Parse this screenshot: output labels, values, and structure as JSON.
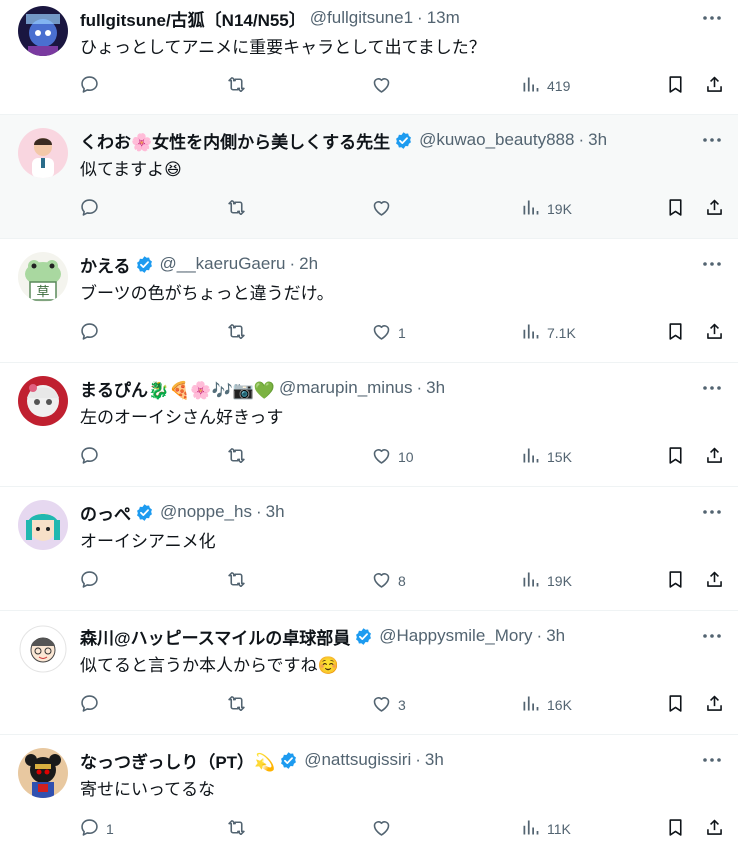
{
  "colors": {
    "text": "#0f1419",
    "secondary": "#536471",
    "verified": "#1d9bf0",
    "divider": "#eff3f4",
    "hover_bg": "#f7f9f9"
  },
  "tweets": [
    {
      "name": "fullgitsune/古狐〔N14/N55〕",
      "handle": "@fullgitsune1",
      "time": "13m",
      "verified": false,
      "text": "ひょっとしてアニメに重要キャラとして出てました？",
      "replies": "",
      "likes": "",
      "views": "419",
      "avatar_icon": "avatar-fullgitsune"
    },
    {
      "name": "くわお🌸女性を内側から美しくする先生",
      "handle": "@kuwao_beauty888",
      "time": "3h",
      "verified": true,
      "text": "似てますよ😆",
      "replies": "",
      "likes": "",
      "views": "19K",
      "avatar_icon": "avatar-kuwao"
    },
    {
      "name": "かえる",
      "handle": "@__kaeruGaeru",
      "time": "2h",
      "verified": true,
      "text": "ブーツの色がちょっと違うだけ。",
      "replies": "",
      "likes": "1",
      "views": "7.1K",
      "avatar_icon": "avatar-frog"
    },
    {
      "name": "まるぴん🐉🍕🌸🎶📷💚",
      "handle": "@marupin_minus",
      "time": "3h",
      "verified": false,
      "text": "左のオーイシさん好きっす",
      "replies": "",
      "likes": "10",
      "views": "15K",
      "avatar_icon": "avatar-marupin"
    },
    {
      "name": "のっぺ",
      "handle": "@noppe_hs",
      "time": "3h",
      "verified": true,
      "text": "オーイシアニメ化",
      "replies": "",
      "likes": "8",
      "views": "19K",
      "avatar_icon": "avatar-noppe"
    },
    {
      "name": "森川@ハッピースマイルの卓球部員",
      "handle": "@Happysmile_Mory",
      "time": "3h",
      "verified": true,
      "text": "似てると言うか本人からですね☺️",
      "replies": "",
      "likes": "3",
      "views": "16K",
      "avatar_icon": "avatar-morikawa"
    },
    {
      "name": "なっつぎっしり（PT）💫",
      "handle": "@nattsugissiri",
      "time": "3h",
      "verified": true,
      "text": "寄せにいってるな",
      "replies": "1",
      "likes": "",
      "views": "11K",
      "avatar_icon": "avatar-nattsu"
    }
  ]
}
